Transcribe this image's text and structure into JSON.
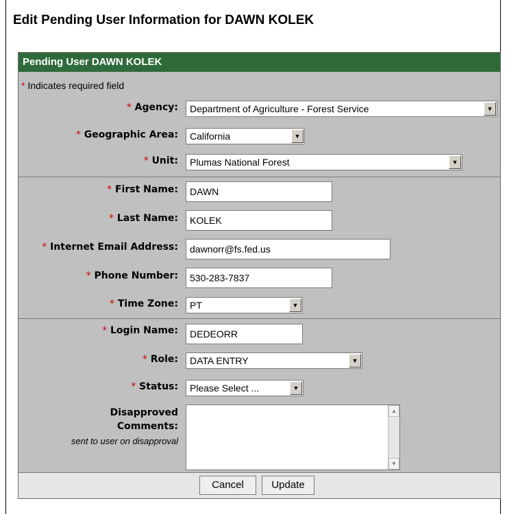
{
  "page": {
    "title": "Edit Pending User Information for DAWN KOLEK"
  },
  "panel": {
    "header": "Pending User DAWN KOLEK",
    "required_mark": "*",
    "required_note": "Indicates required field"
  },
  "form": {
    "agency": {
      "label": "Agency:",
      "value": "Department of Agriculture - Forest Service"
    },
    "geographic_area": {
      "label": "Geographic Area:",
      "value": "California"
    },
    "unit": {
      "label": "Unit:",
      "value": "Plumas National Forest"
    },
    "first_name": {
      "label": "First Name:",
      "value": "DAWN"
    },
    "last_name": {
      "label": "Last Name:",
      "value": "KOLEK"
    },
    "email": {
      "label": "Internet Email Address:",
      "value": "dawnorr@fs.fed.us"
    },
    "phone": {
      "label": "Phone Number:",
      "value": "530-283-7837"
    },
    "time_zone": {
      "label": "Time Zone:",
      "value": "PT"
    },
    "login_name": {
      "label": "Login Name:",
      "value": "DEDEORR"
    },
    "role": {
      "label": "Role:",
      "value": "DATA ENTRY"
    },
    "status": {
      "label": "Status:",
      "value": "Please Select ..."
    },
    "disapproved": {
      "label_line1": "Disapproved",
      "label_line2": "Comments:",
      "sublabel": "sent to user on disapproval",
      "value": ""
    }
  },
  "buttons": {
    "cancel": "Cancel",
    "update": "Update"
  },
  "colors": {
    "header_bg": "#2f6b3a",
    "panel_bg": "#c0c0c0",
    "required": "#cc0000"
  }
}
